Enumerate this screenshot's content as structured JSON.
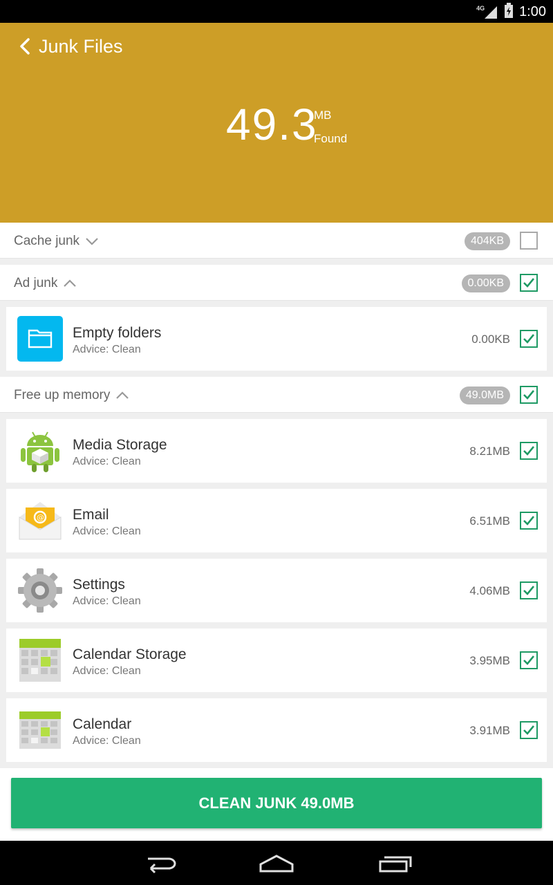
{
  "status_bar": {
    "time": "1:00",
    "network": "4G",
    "icons": [
      "signal-icon",
      "battery-icon"
    ]
  },
  "header": {
    "title": "Junk Files",
    "total_value": "49.3",
    "total_unit": "MB",
    "total_caption": "Found",
    "background_color": "#cd9e27"
  },
  "sections": [
    {
      "label": "Cache junk",
      "size": "404KB",
      "expanded": false,
      "checked": false
    },
    {
      "label": "Ad junk",
      "size": "0.00KB",
      "expanded": true,
      "checked": true
    },
    {
      "label": "Free up memory",
      "size": "49.0MB",
      "expanded": true,
      "checked": true
    }
  ],
  "ad_items": [
    {
      "name": "Empty folders",
      "advice": "Advice: Clean",
      "size": "0.00KB",
      "checked": true,
      "icon": "folder-icon"
    }
  ],
  "memory_items": [
    {
      "name": "Media Storage",
      "advice": "Advice: Clean",
      "size": "8.21MB",
      "checked": true,
      "icon": "android-icon"
    },
    {
      "name": "Email",
      "advice": "Advice: Clean",
      "size": "6.51MB",
      "checked": true,
      "icon": "email-icon"
    },
    {
      "name": "Settings",
      "advice": "Advice: Clean",
      "size": "4.06MB",
      "checked": true,
      "icon": "gear-icon"
    },
    {
      "name": "Calendar Storage",
      "advice": "Advice: Clean",
      "size": "3.95MB",
      "checked": true,
      "icon": "calendar-icon"
    },
    {
      "name": "Calendar",
      "advice": "Advice: Clean",
      "size": "3.91MB",
      "checked": true,
      "icon": "calendar-icon"
    }
  ],
  "clean_button": {
    "label": "CLEAN JUNK 49.0MB",
    "color": "#21b273"
  },
  "nav_bar": {
    "icons": [
      "back-icon",
      "home-icon",
      "recents-icon"
    ]
  }
}
